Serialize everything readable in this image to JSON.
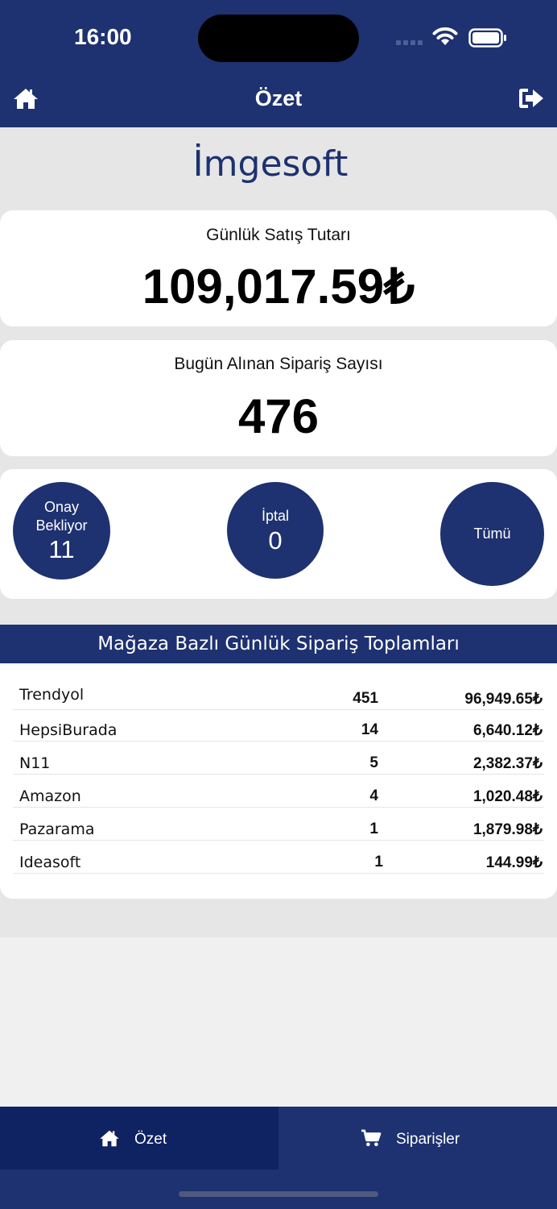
{
  "status_bar": {
    "time": "16:00"
  },
  "nav": {
    "title": "Özet"
  },
  "brand": "İmgesoft",
  "daily_sales": {
    "label": "Günlük Satış Tutarı",
    "value": "109,017.59₺"
  },
  "orders_today": {
    "label": "Bugün Alınan Sipariş Sayısı",
    "value": "476"
  },
  "status_circles": {
    "pending": {
      "label_line1": "Onay",
      "label_line2": "Bekliyor",
      "value": "11"
    },
    "cancelled": {
      "label": "İptal",
      "value": "0"
    },
    "all": {
      "label": "Tümü"
    }
  },
  "store_table": {
    "title": "Mağaza Bazlı Günlük Sipariş Toplamları",
    "rows": [
      {
        "store": "Trendyol",
        "count": "451",
        "amount": "96,949.65₺"
      },
      {
        "store": "HepsiBurada",
        "count": "14",
        "amount": "6,640.12₺"
      },
      {
        "store": "N11",
        "count": "5",
        "amount": "2,382.37₺"
      },
      {
        "store": "Amazon",
        "count": "4",
        "amount": "1,020.48₺"
      },
      {
        "store": "Pazarama",
        "count": "1",
        "amount": "1,879.98₺"
      },
      {
        "store": "Ideasoft",
        "count": "1",
        "amount": "144.99₺"
      }
    ]
  },
  "tabs": [
    {
      "label": "Özet",
      "icon": "home-icon",
      "active": true
    },
    {
      "label": "Siparişler",
      "icon": "cart-icon",
      "active": false
    }
  ],
  "colors": {
    "primary": "#1e3170",
    "active_tab": "#0f2261",
    "background": "#e6e6e6"
  }
}
